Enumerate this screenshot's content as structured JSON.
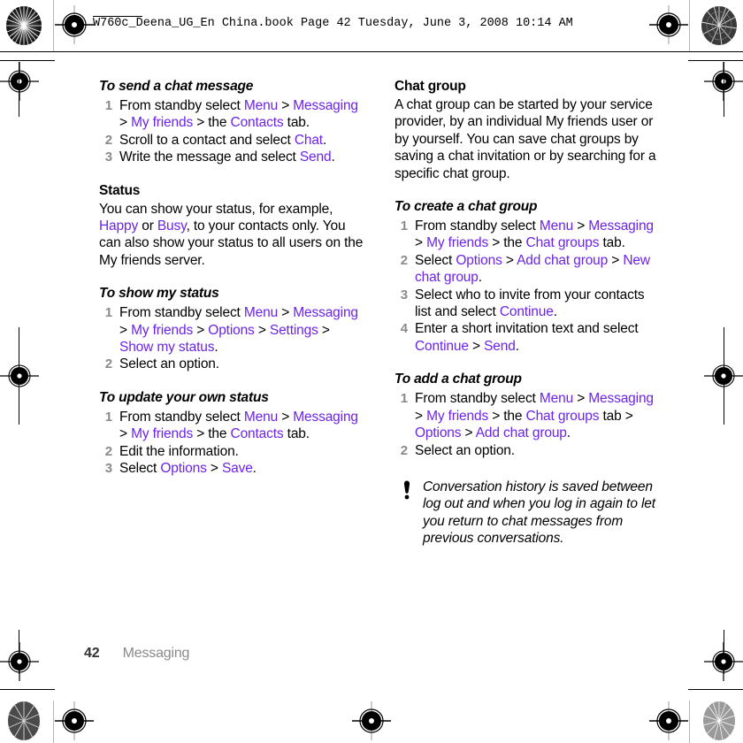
{
  "header": {
    "text": "W760c_Deena_UG_En China.book  Page 42  Tuesday, June 3, 2008  10:14 AM"
  },
  "footer": {
    "page_number": "42",
    "chapter": "Messaging"
  },
  "colors": {
    "ui_term": "#6b24e8",
    "step_number": "#8a8a8a",
    "body_text": "#000000",
    "footer_chapter": "#8a8a8a"
  },
  "left_column": {
    "section1": {
      "heading": "To send a chat message",
      "steps": [
        {
          "num": "1",
          "parts": [
            {
              "t": "From standby select ",
              "ui": false
            },
            {
              "t": "Menu",
              "ui": true
            },
            {
              "t": " > ",
              "ui": false
            },
            {
              "t": "Messaging",
              "ui": true
            },
            {
              "t": " > ",
              "ui": false
            },
            {
              "t": "My friends",
              "ui": true
            },
            {
              "t": " > the ",
              "ui": false
            },
            {
              "t": "Contacts",
              "ui": true
            },
            {
              "t": " tab.",
              "ui": false
            }
          ]
        },
        {
          "num": "2",
          "parts": [
            {
              "t": "Scroll to a contact and select ",
              "ui": false
            },
            {
              "t": "Chat",
              "ui": true
            },
            {
              "t": ".",
              "ui": false
            }
          ]
        },
        {
          "num": "3",
          "parts": [
            {
              "t": "Write the message and select ",
              "ui": false
            },
            {
              "t": "Send",
              "ui": true
            },
            {
              "t": ".",
              "ui": false
            }
          ]
        }
      ]
    },
    "section2": {
      "heading": "Status",
      "paragraph_parts": [
        {
          "t": "You can show your status, for example, ",
          "ui": false
        },
        {
          "t": "Happy",
          "ui": true
        },
        {
          "t": " or ",
          "ui": false
        },
        {
          "t": "Busy",
          "ui": true
        },
        {
          "t": ", to your contacts only. You can also show your status to all users on the My friends server.",
          "ui": false
        }
      ]
    },
    "section3": {
      "heading": "To show my status",
      "steps": [
        {
          "num": "1",
          "parts": [
            {
              "t": "From standby select ",
              "ui": false
            },
            {
              "t": "Menu",
              "ui": true
            },
            {
              "t": " > ",
              "ui": false
            },
            {
              "t": "Messaging",
              "ui": true
            },
            {
              "t": " > ",
              "ui": false
            },
            {
              "t": "My friends",
              "ui": true
            },
            {
              "t": " > ",
              "ui": false
            },
            {
              "t": "Options",
              "ui": true
            },
            {
              "t": " > ",
              "ui": false
            },
            {
              "t": "Settings",
              "ui": true
            },
            {
              "t": " > ",
              "ui": false
            },
            {
              "t": "Show my status",
              "ui": true
            },
            {
              "t": ".",
              "ui": false
            }
          ]
        },
        {
          "num": "2",
          "parts": [
            {
              "t": "Select an option.",
              "ui": false
            }
          ]
        }
      ]
    },
    "section4": {
      "heading": "To update your own status",
      "steps": [
        {
          "num": "1",
          "parts": [
            {
              "t": "From standby select ",
              "ui": false
            },
            {
              "t": "Menu",
              "ui": true
            },
            {
              "t": " > ",
              "ui": false
            },
            {
              "t": "Messaging",
              "ui": true
            },
            {
              "t": " > ",
              "ui": false
            },
            {
              "t": "My friends",
              "ui": true
            },
            {
              "t": " > the ",
              "ui": false
            },
            {
              "t": "Contacts",
              "ui": true
            },
            {
              "t": " tab.",
              "ui": false
            }
          ]
        },
        {
          "num": "2",
          "parts": [
            {
              "t": "Edit the information.",
              "ui": false
            }
          ]
        },
        {
          "num": "3",
          "parts": [
            {
              "t": "Select ",
              "ui": false
            },
            {
              "t": "Options",
              "ui": true
            },
            {
              "t": " > ",
              "ui": false
            },
            {
              "t": "Save",
              "ui": true
            },
            {
              "t": ".",
              "ui": false
            }
          ]
        }
      ]
    }
  },
  "right_column": {
    "section1": {
      "heading": "Chat group",
      "paragraph_parts": [
        {
          "t": "A chat group can be started by your service provider, by an individual My friends user or by yourself. You can save chat groups by saving a chat invitation or by searching for a specific chat group.",
          "ui": false
        }
      ]
    },
    "section2": {
      "heading": "To create a chat group",
      "steps": [
        {
          "num": "1",
          "parts": [
            {
              "t": "From standby select ",
              "ui": false
            },
            {
              "t": "Menu",
              "ui": true
            },
            {
              "t": " > ",
              "ui": false
            },
            {
              "t": "Messaging",
              "ui": true
            },
            {
              "t": " > ",
              "ui": false
            },
            {
              "t": "My friends",
              "ui": true
            },
            {
              "t": " > the ",
              "ui": false
            },
            {
              "t": "Chat groups",
              "ui": true
            },
            {
              "t": " tab.",
              "ui": false
            }
          ]
        },
        {
          "num": "2",
          "parts": [
            {
              "t": "Select ",
              "ui": false
            },
            {
              "t": "Options",
              "ui": true
            },
            {
              "t": " > ",
              "ui": false
            },
            {
              "t": "Add chat group",
              "ui": true
            },
            {
              "t": " > ",
              "ui": false
            },
            {
              "t": "New chat group",
              "ui": true
            },
            {
              "t": ".",
              "ui": false
            }
          ]
        },
        {
          "num": "3",
          "parts": [
            {
              "t": "Select who to invite from your contacts list and select ",
              "ui": false
            },
            {
              "t": "Continue",
              "ui": true
            },
            {
              "t": ".",
              "ui": false
            }
          ]
        },
        {
          "num": "4",
          "parts": [
            {
              "t": "Enter a short invitation text and select ",
              "ui": false
            },
            {
              "t": "Continue",
              "ui": true
            },
            {
              "t": " > ",
              "ui": false
            },
            {
              "t": "Send",
              "ui": true
            },
            {
              "t": ".",
              "ui": false
            }
          ]
        }
      ]
    },
    "section3": {
      "heading": "To add a chat group",
      "steps": [
        {
          "num": "1",
          "parts": [
            {
              "t": "From standby select ",
              "ui": false
            },
            {
              "t": "Menu",
              "ui": true
            },
            {
              "t": " > ",
              "ui": false
            },
            {
              "t": "Messaging",
              "ui": true
            },
            {
              "t": " > ",
              "ui": false
            },
            {
              "t": "My friends",
              "ui": true
            },
            {
              "t": " > the ",
              "ui": false
            },
            {
              "t": "Chat groups",
              "ui": true
            },
            {
              "t": " tab > ",
              "ui": false
            },
            {
              "t": "Options",
              "ui": true
            },
            {
              "t": " > ",
              "ui": false
            },
            {
              "t": "Add chat group",
              "ui": true
            },
            {
              "t": ".",
              "ui": false
            }
          ]
        },
        {
          "num": "2",
          "parts": [
            {
              "t": "Select an option.",
              "ui": false
            }
          ]
        }
      ]
    },
    "note": {
      "icon": "exclamation-icon",
      "text": "Conversation history is saved between log out and when you log in again to let you return to chat messages from previous conversations."
    }
  },
  "printer_marks": {
    "registration_icon": "registration-target-icon",
    "halftone_icon": "halftone-density-patch-icon"
  }
}
